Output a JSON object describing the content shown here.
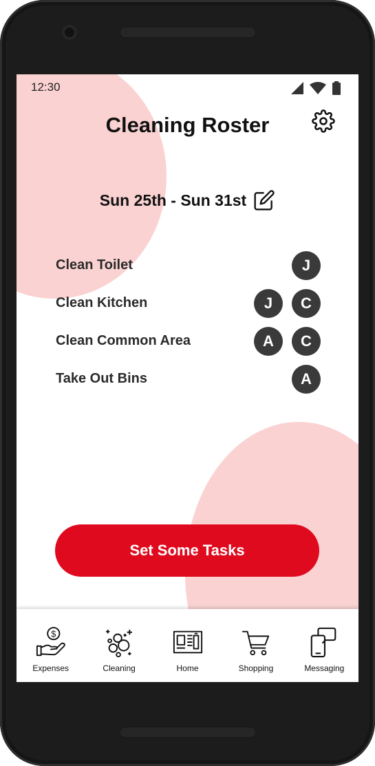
{
  "status_bar": {
    "time": "12:30"
  },
  "header": {
    "title": "Cleaning Roster"
  },
  "week": {
    "range": "Sun 25th - Sun 31st"
  },
  "tasks": [
    {
      "name": "Clean Toilet",
      "assignees": [
        "J"
      ]
    },
    {
      "name": "Clean Kitchen",
      "assignees": [
        "J",
        "C"
      ]
    },
    {
      "name": "Clean Common Area",
      "assignees": [
        "A",
        "C"
      ]
    },
    {
      "name": "Take Out Bins",
      "assignees": [
        "A"
      ]
    }
  ],
  "cta": {
    "label": "Set Some Tasks"
  },
  "nav": {
    "items": [
      {
        "label": "Expenses",
        "icon": "expenses-icon"
      },
      {
        "label": "Cleaning",
        "icon": "cleaning-icon"
      },
      {
        "label": "Home",
        "icon": "home-icon"
      },
      {
        "label": "Shopping",
        "icon": "shopping-cart-icon"
      },
      {
        "label": "Messaging",
        "icon": "messaging-icon"
      }
    ]
  },
  "colors": {
    "accent": "#e00a1e",
    "blob": "#fad2d2",
    "avatar": "#3a3a3a",
    "frame": "#1c1c1c"
  }
}
